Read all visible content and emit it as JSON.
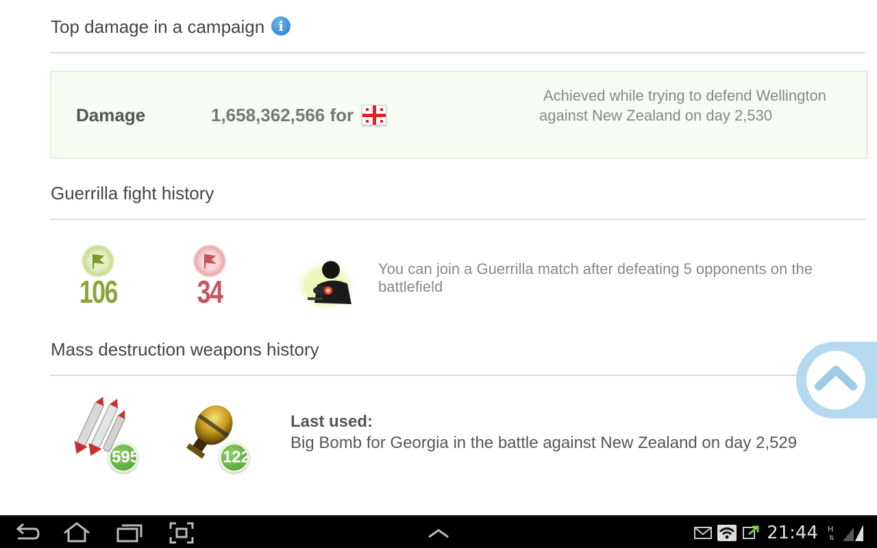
{
  "top_damage": {
    "title": "Top damage in a campaign",
    "info_glyph": "i",
    "label": "Damage",
    "value": "1,658,362,566 for",
    "flag_icon": "georgia-flag-icon",
    "description": "Achieved while trying to defend Wellington against New Zealand on day 2,530"
  },
  "guerrilla": {
    "title": "Guerrilla fight history",
    "wins": "106",
    "losses": "34",
    "wins_color": "#8aa63a",
    "losses_color": "#c8545c",
    "message": "You can join a Guerrilla match after defeating 5 opponents on the battlefield"
  },
  "mass_destruction": {
    "title": "Mass destruction weapons history",
    "weapons": [
      {
        "icon": "rockets-icon",
        "count": "595"
      },
      {
        "icon": "big-bomb-icon",
        "count": "122"
      }
    ],
    "last_used_label": "Last used:",
    "last_used_text": "Big Bomb for Georgia in the battle against New Zealand on day 2,529"
  },
  "system_bar": {
    "time": "21:44",
    "buttons": [
      "back-icon",
      "home-icon",
      "recent-apps-icon",
      "screenshot-icon",
      "menu-up-icon"
    ],
    "status_icons": [
      "gmail-icon",
      "wifi-icon",
      "sync-icon",
      "signal-icon"
    ]
  },
  "colors": {
    "accent_info": "#2377c7",
    "damage_box_bg": "#f6fbf3",
    "scroll_button": "#b5d9ee"
  }
}
